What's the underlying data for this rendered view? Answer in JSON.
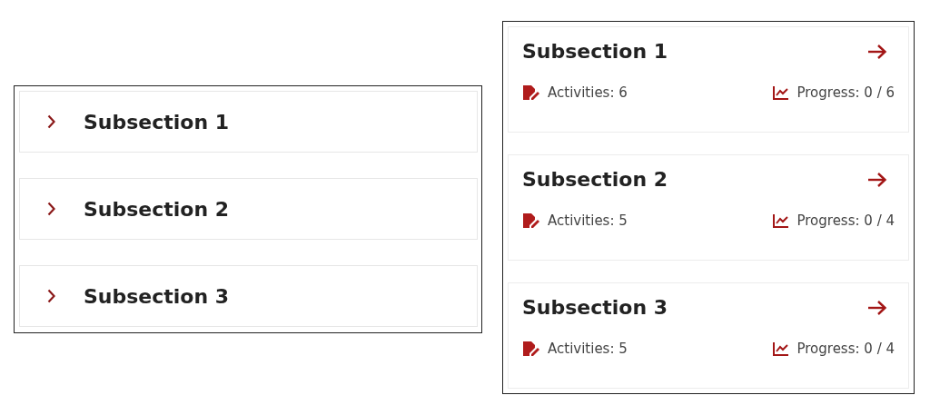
{
  "accordion": {
    "items": [
      {
        "title": "Subsection 1"
      },
      {
        "title": "Subsection 2"
      },
      {
        "title": "Subsection 3"
      }
    ]
  },
  "cards": {
    "items": [
      {
        "title": "Subsection 1",
        "activities": "Activities: 6",
        "progress": "Progress: 0 / 6"
      },
      {
        "title": "Subsection 2",
        "activities": "Activities: 5",
        "progress": "Progress: 0 / 4"
      },
      {
        "title": "Subsection 3",
        "activities": "Activities: 5",
        "progress": "Progress: 0 / 4"
      }
    ]
  }
}
